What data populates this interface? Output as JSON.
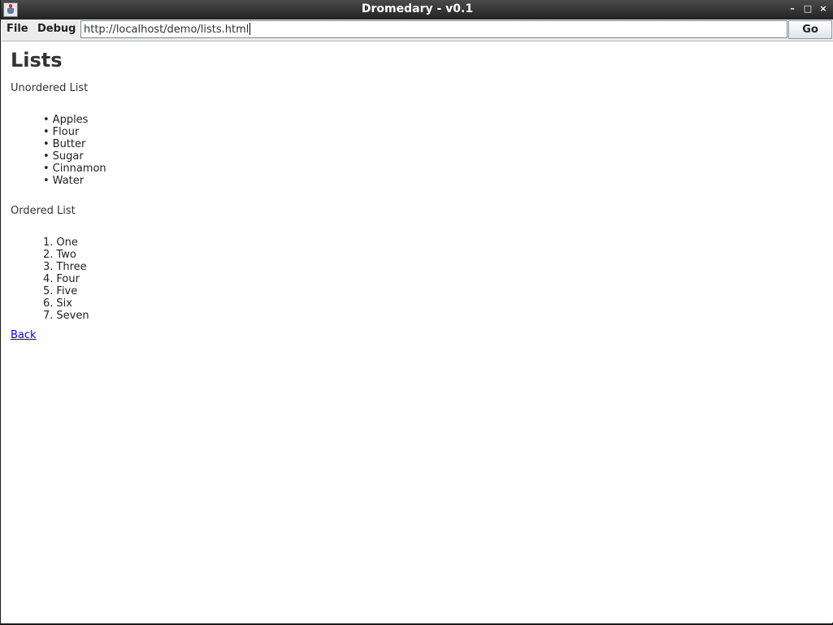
{
  "window": {
    "title": "Dromedary - v0.1",
    "controls": {
      "minimize": "–",
      "maximize": "□",
      "close": "×"
    }
  },
  "toolbar": {
    "menu": [
      "File",
      "Debug"
    ],
    "url": "http://localhost/demo/lists.html",
    "go_label": "Go"
  },
  "page": {
    "title": "Lists",
    "unordered_heading": "Unordered List",
    "unordered_items": [
      "Apples",
      "Flour",
      "Butter",
      "Sugar",
      "Cinnamon",
      "Water"
    ],
    "ordered_heading": "Ordered List",
    "ordered_items": [
      "One",
      "Two",
      "Three",
      "Four",
      "Five",
      "Six",
      "Seven"
    ],
    "back_link": "Back"
  },
  "colors": {
    "titlebar": "#2e2e2e",
    "link": "#0000ee",
    "text": "#333333"
  }
}
